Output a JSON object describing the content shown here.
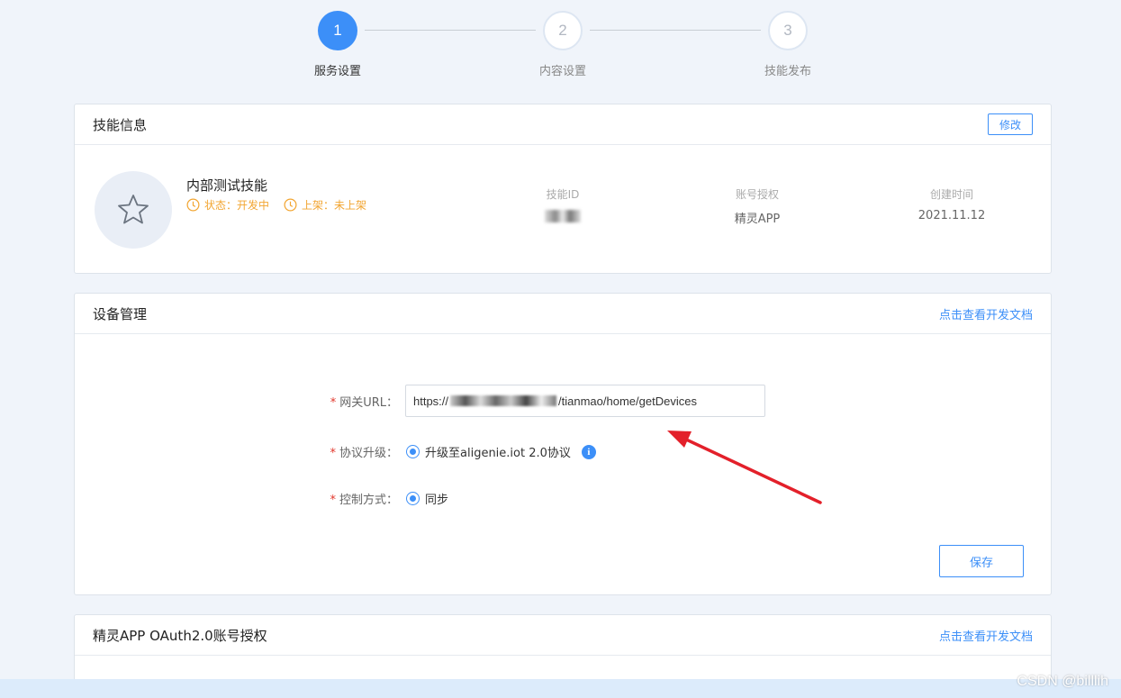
{
  "steps": [
    {
      "number": "1",
      "label": "服务设置",
      "state": "active"
    },
    {
      "number": "2",
      "label": "内容设置",
      "state": "inactive"
    },
    {
      "number": "3",
      "label": "技能发布",
      "state": "inactive"
    }
  ],
  "skill_info": {
    "title": "技能信息",
    "edit_label": "修改",
    "name": "内部测试技能",
    "status_tag": "状态：开发中",
    "shelf_tag": "上架：未上架",
    "meta": {
      "skill_id_label": "技能ID",
      "auth_label": "账号授权",
      "auth_value": "精灵APP",
      "created_label": "创建时间",
      "created_value": "2021.11.12"
    }
  },
  "device_mgmt": {
    "title": "设备管理",
    "doc_link": "点击查看开发文档",
    "gateway_label": "网关URL：",
    "gateway_prefix": "https://",
    "gateway_suffix": "/tianmao/home/getDevices",
    "protocol_label": "协议升级：",
    "protocol_option": "升级至aligenie.iot 2.0协议",
    "control_label": "控制方式：",
    "control_option": "同步",
    "save_label": "保存"
  },
  "oauth": {
    "title": "精灵APP OAuth2.0账号授权",
    "doc_link": "点击查看开发文档"
  },
  "watermark": "CSDN @billlih",
  "colors": {
    "accent": "#3c8ff8",
    "warning": "#f2a531",
    "required": "#e2362b",
    "annotation_arrow": "#e3202a"
  }
}
